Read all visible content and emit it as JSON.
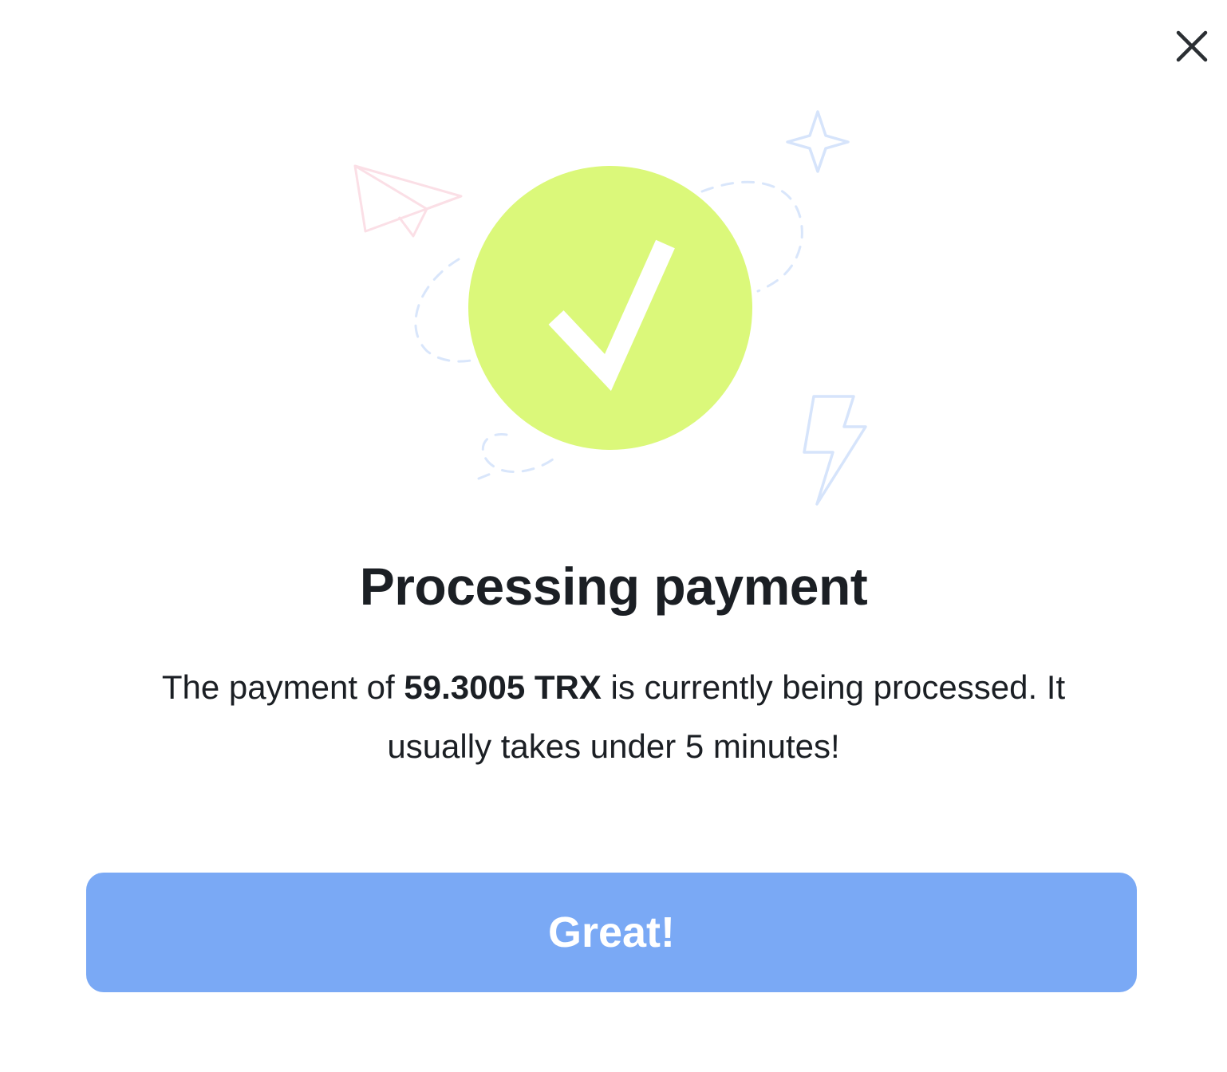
{
  "dialog": {
    "title": "Processing payment",
    "message_prefix": "The payment of ",
    "amount": "59.3005 TRX",
    "message_suffix": " is currently being processed. It usually takes under 5 minutes!",
    "confirm_label": "Great!"
  },
  "icons": {
    "close": "close-icon",
    "success": "checkmark-circle-icon",
    "decor": [
      "paper-plane-icon",
      "sparkle-star-icon",
      "lightning-bolt-icon",
      "dashed-orbit"
    ]
  },
  "colors": {
    "success_circle": "#dbf87a",
    "button": "#7aa9f5",
    "text": "#1b1f24",
    "decor_blue": "#d6e4fb",
    "decor_pink": "#fbe0e6"
  }
}
